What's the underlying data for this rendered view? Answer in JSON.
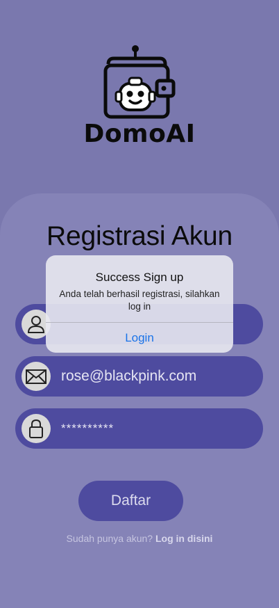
{
  "brand": {
    "name": "DomoAI"
  },
  "form": {
    "title": "Registrasi Akun",
    "name_value": "",
    "email_value": "rose@blackpink.com",
    "password_value": "**********",
    "submit_label": "Daftar"
  },
  "footer": {
    "prompt": "Sudah punya akun?",
    "link_label": "Log in disini"
  },
  "alert": {
    "title": "Success Sign up",
    "message": "Anda telah berhasil registrasi, silahkan log in",
    "button_label": "Login"
  },
  "colors": {
    "background": "#7a78ae",
    "card": "#8583b7",
    "field": "#4e4b9f",
    "alert_button": "#1a73e8"
  },
  "icons": [
    "robot-wallet-logo-icon",
    "user-icon",
    "mail-icon",
    "lock-icon"
  ]
}
